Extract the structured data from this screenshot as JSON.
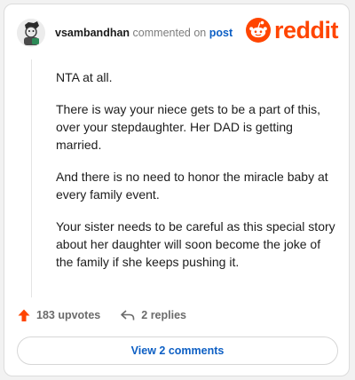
{
  "comment": {
    "username": "vsambandhan",
    "action_text": "commented on",
    "post_link": "post",
    "paragraphs": [
      "NTA at all.",
      "There is way your niece gets to be a part of this, over your stepdaughter. Her DAD is getting married.",
      "And there is no need to honor the miracle baby at every family event.",
      "Your sister needs to be careful as this special story about her daughter will soon become the joke of the family if she keeps pushing it."
    ]
  },
  "brand": {
    "wordmark": "reddit",
    "accent": "#ff4500"
  },
  "actions": {
    "upvotes": "183 upvotes",
    "replies": "2 replies",
    "view_comments": "View 2 comments"
  },
  "icons": {
    "avatar": "avatar-icon",
    "logo": "reddit-snoo-icon",
    "upvote": "upvote-arrow-icon",
    "reply": "reply-arrow-icon"
  }
}
